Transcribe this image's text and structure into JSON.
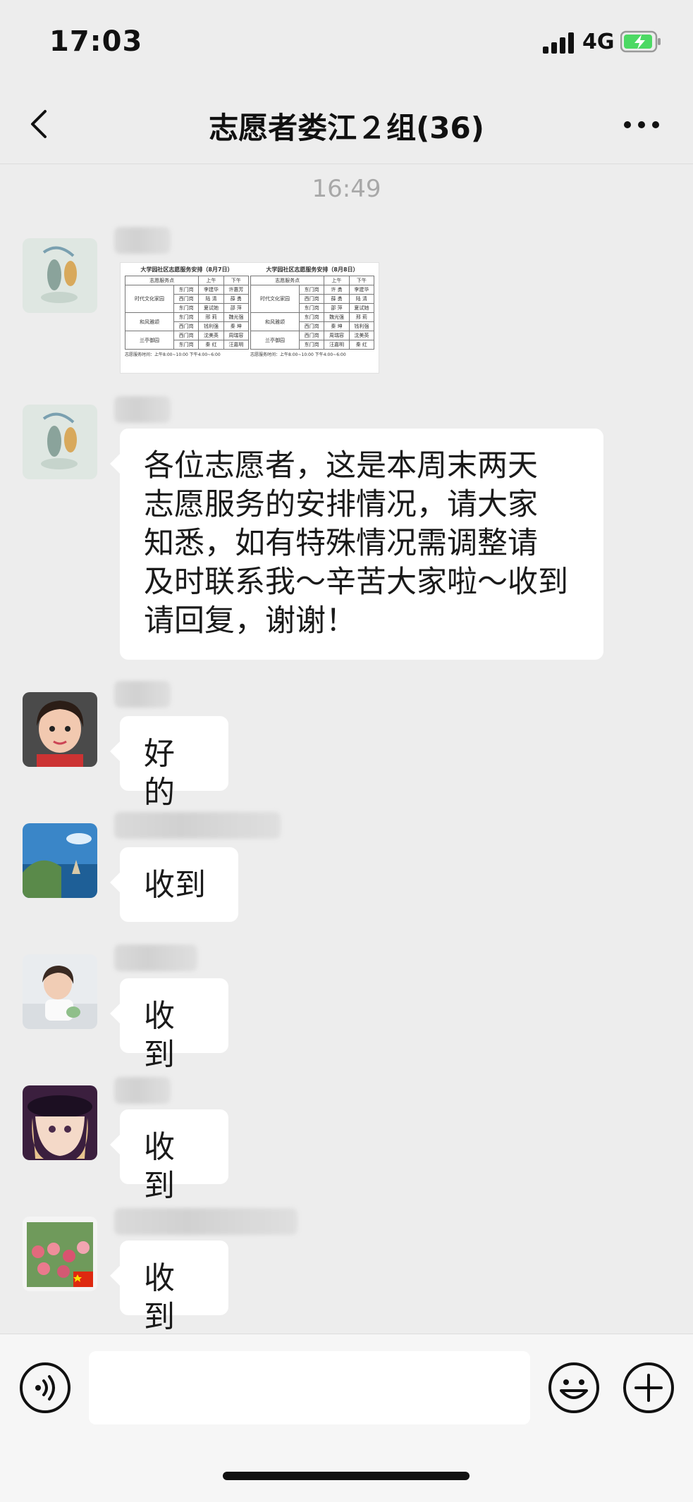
{
  "status": {
    "time": "17:03",
    "network": "4G"
  },
  "header": {
    "title": "志愿者娄江２组(36)"
  },
  "chat": {
    "timestamp": "16:49",
    "image_message": {
      "tables": [
        {
          "title": "大学园社区志愿服务安排（8月7日）",
          "header": [
            "志愿服务点",
            "",
            "上午",
            "下午"
          ],
          "rows": [
            [
              "时代文化家园",
              "东门岗",
              "李建华",
              "许惠芳"
            ],
            [
              "",
              "西门岗",
              "陆 清",
              "薛 勇"
            ],
            [
              "",
              "东门岗",
              "夏试她",
              "邵 萍"
            ],
            [
              "和风雅颂",
              "东门岗",
              "邢 莉",
              "魏光强"
            ],
            [
              "",
              "西门岗",
              "钱利强",
              "秦 坤"
            ],
            [
              "兰亭御园",
              "西门岗",
              "沈美英",
              "周瑞容"
            ],
            [
              "",
              "东门岗",
              "秦 红",
              "汪嘉明"
            ]
          ],
          "footer": "志愿服务时间：上午8:00~10:00 下午4:00~6:00"
        },
        {
          "title": "大学园社区志愿服务安排（8月8日）",
          "header": [
            "志愿服务点",
            "",
            "上午",
            "下午"
          ],
          "rows": [
            [
              "时代文化家园",
              "东门岗",
              "许 勇",
              "李建华"
            ],
            [
              "",
              "西门岗",
              "薛 勇",
              "陆 清"
            ],
            [
              "",
              "东门岗",
              "邵 萍",
              "夏试她"
            ],
            [
              "和风雅颂",
              "东门岗",
              "魏光强",
              "邢 莉"
            ],
            [
              "",
              "西门岗",
              "秦 坤",
              "钱利强"
            ],
            [
              "兰亭御园",
              "西门岗",
              "周瑞容",
              "沈美英"
            ],
            [
              "",
              "东门岗",
              "汪嘉明",
              "秦 红"
            ]
          ],
          "footer": "志愿服务时间：上午8:00~10:00 下午4:00~6:00"
        }
      ]
    },
    "messages": [
      {
        "text": "各位志愿者，这是本周末两天\n志愿服务的安排情况，请大家\n知悉，如有特殊情况需调整请\n及时联系我～辛苦大家啦～收到\n请回复，谢谢！"
      },
      {
        "text": "好的"
      },
      {
        "text": "收到"
      },
      {
        "text": "收到"
      },
      {
        "text": "收到"
      },
      {
        "text": "收到"
      }
    ]
  },
  "input": {
    "placeholder": ""
  },
  "icons": [
    "back-chevron-icon",
    "more-icon",
    "voice-icon",
    "emoji-icon",
    "add-icon"
  ]
}
